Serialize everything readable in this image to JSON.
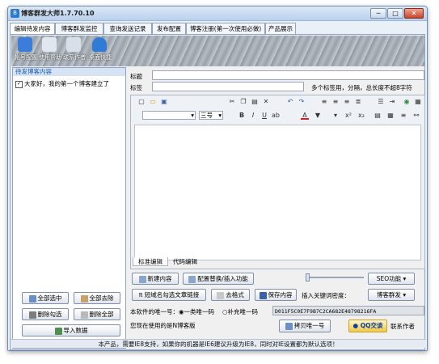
{
  "window": {
    "title": "博客群发大师1.7.70.10",
    "controls": [
      "─",
      "□",
      "✕"
    ]
  },
  "tabs": [
    {
      "label": "编辑待发内容",
      "active": true
    },
    {
      "label": "博客群发监控",
      "active": false
    },
    {
      "label": "查询发送记录",
      "active": false
    },
    {
      "label": "发布配置",
      "active": false
    },
    {
      "label": "博客注册(第一次使用必做)",
      "active": false
    },
    {
      "label": "产品展示",
      "active": false
    }
  ],
  "toolbar": {
    "items": [
      {
        "label": "帐号配置",
        "icon": "account-config-icon",
        "color": "#3b7dd8"
      },
      {
        "label": "使用帮助",
        "icon": "help-book-icon",
        "color": "#e2e6ee"
      },
      {
        "label": "联系作者",
        "icon": "contact-author-icon",
        "color": "#d8dfe9"
      },
      {
        "label": "桌面快捷",
        "icon": "desktop-shortcut-icon",
        "color": "#2f7bd6"
      }
    ]
  },
  "left_panel": {
    "title": "待发博客内容",
    "items": [
      {
        "label": "大家好，我的第一个博客建立了",
        "checked": true
      }
    ],
    "buttons": {
      "select_all": "全部选中",
      "remove_all": "全部去除",
      "delete_checked": "删除勾选",
      "delete_all": "删除全部",
      "import": "导入数据"
    }
  },
  "form": {
    "title_label": "标题",
    "title_value": "",
    "tags_label": "标签",
    "tags_value": "",
    "tags_hint": "多个标签用，分隔，总长度不超8字符"
  },
  "editor": {
    "font_name": "",
    "font_size": "三号",
    "tab_design": "标准编辑",
    "tab_code": "代码编辑"
  },
  "actions": {
    "new_content": "新建内容",
    "config_replace": "配置替换/插入功能",
    "seo": "SEO功能",
    "short_link": "短域名勾选文章链接",
    "remove_format": "去格式",
    "save_content": "保存内容",
    "insert_keyword_label": "插入关键词密度：",
    "blog_send": "博客群发"
  },
  "license": {
    "label": "本软件的唯一号：",
    "option_1": "一类唯一码",
    "option_2": "补充唯一码",
    "code": "D011F5C0E7F9B7C2CA682E48798216FA",
    "copy_button": "拷贝唯一号",
    "version_note": "您现在使用的是N博客版",
    "qq_button": "QQ交谈",
    "contact_button": "联系作者"
  },
  "status_bar": {
    "text": "本产品，需要IE8支持，如果你的机器是IE6建议升级为IE8，同时对IE设置都为默认选项！"
  }
}
